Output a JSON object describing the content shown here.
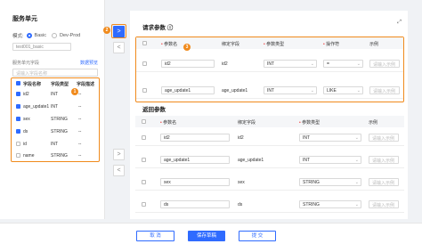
{
  "left": {
    "title": "服务单元",
    "mode_label": "模式:",
    "mode_basic": "Basic",
    "mode_devprod": "Dev-Prod",
    "unit_select": "test001_basic",
    "table_label": "服务单元字段",
    "data_preview": "数据预览",
    "search_placeholder": "请输入字段名称",
    "headers": [
      "字段名称",
      "字段类型",
      "字段描述"
    ],
    "fields": [
      {
        "name": "id2",
        "type": "INT",
        "desc": "--",
        "checked": true
      },
      {
        "name": "age_update1",
        "type": "INT",
        "desc": "--",
        "checked": true
      },
      {
        "name": "sex",
        "type": "STRING",
        "desc": "--",
        "checked": true
      },
      {
        "name": "ds",
        "type": "STRING",
        "desc": "--",
        "checked": true
      },
      {
        "name": "id",
        "type": "INT",
        "desc": "--",
        "checked": false
      },
      {
        "name": "name",
        "type": "STRING",
        "desc": "--",
        "checked": false
      }
    ]
  },
  "transfer": {
    "right_arrow": ">",
    "left_arrow": "<",
    "up_arrow": ">",
    "down_arrow": "<"
  },
  "badges": {
    "b1": "1",
    "b2": "2",
    "b3": "3"
  },
  "request": {
    "title": "请求参数 ⓘ",
    "headers": [
      "参数名",
      "绑定字段",
      "参数类型",
      "操作符",
      "示例"
    ],
    "rows": [
      {
        "param": "id2",
        "field": "id2",
        "type": "INT",
        "op": "=",
        "example": "请输入示例"
      },
      {
        "param": "age_update1",
        "field": "age_update1",
        "type": "INT",
        "op": "LIKE",
        "example": "请输入示例"
      }
    ]
  },
  "response": {
    "title": "返回参数",
    "headers": [
      "参数名",
      "绑定字段",
      "参数类型",
      "示例"
    ],
    "rows": [
      {
        "param": "id2",
        "field": "id2",
        "type": "INT",
        "example": "请输入示例"
      },
      {
        "param": "age_update1",
        "field": "age_update1",
        "type": "INT",
        "example": "请输入示例"
      },
      {
        "param": "sex",
        "field": "sex",
        "type": "STRING",
        "example": "请输入示例"
      },
      {
        "param": "ds",
        "field": "ds",
        "type": "STRING",
        "example": "请输入示例"
      }
    ]
  },
  "footer": {
    "cancel": "取 消",
    "save_draft": "保存草稿",
    "submit": "提 交"
  },
  "colors": {
    "accent": "#2f6bff",
    "highlight": "#f08a1c"
  }
}
